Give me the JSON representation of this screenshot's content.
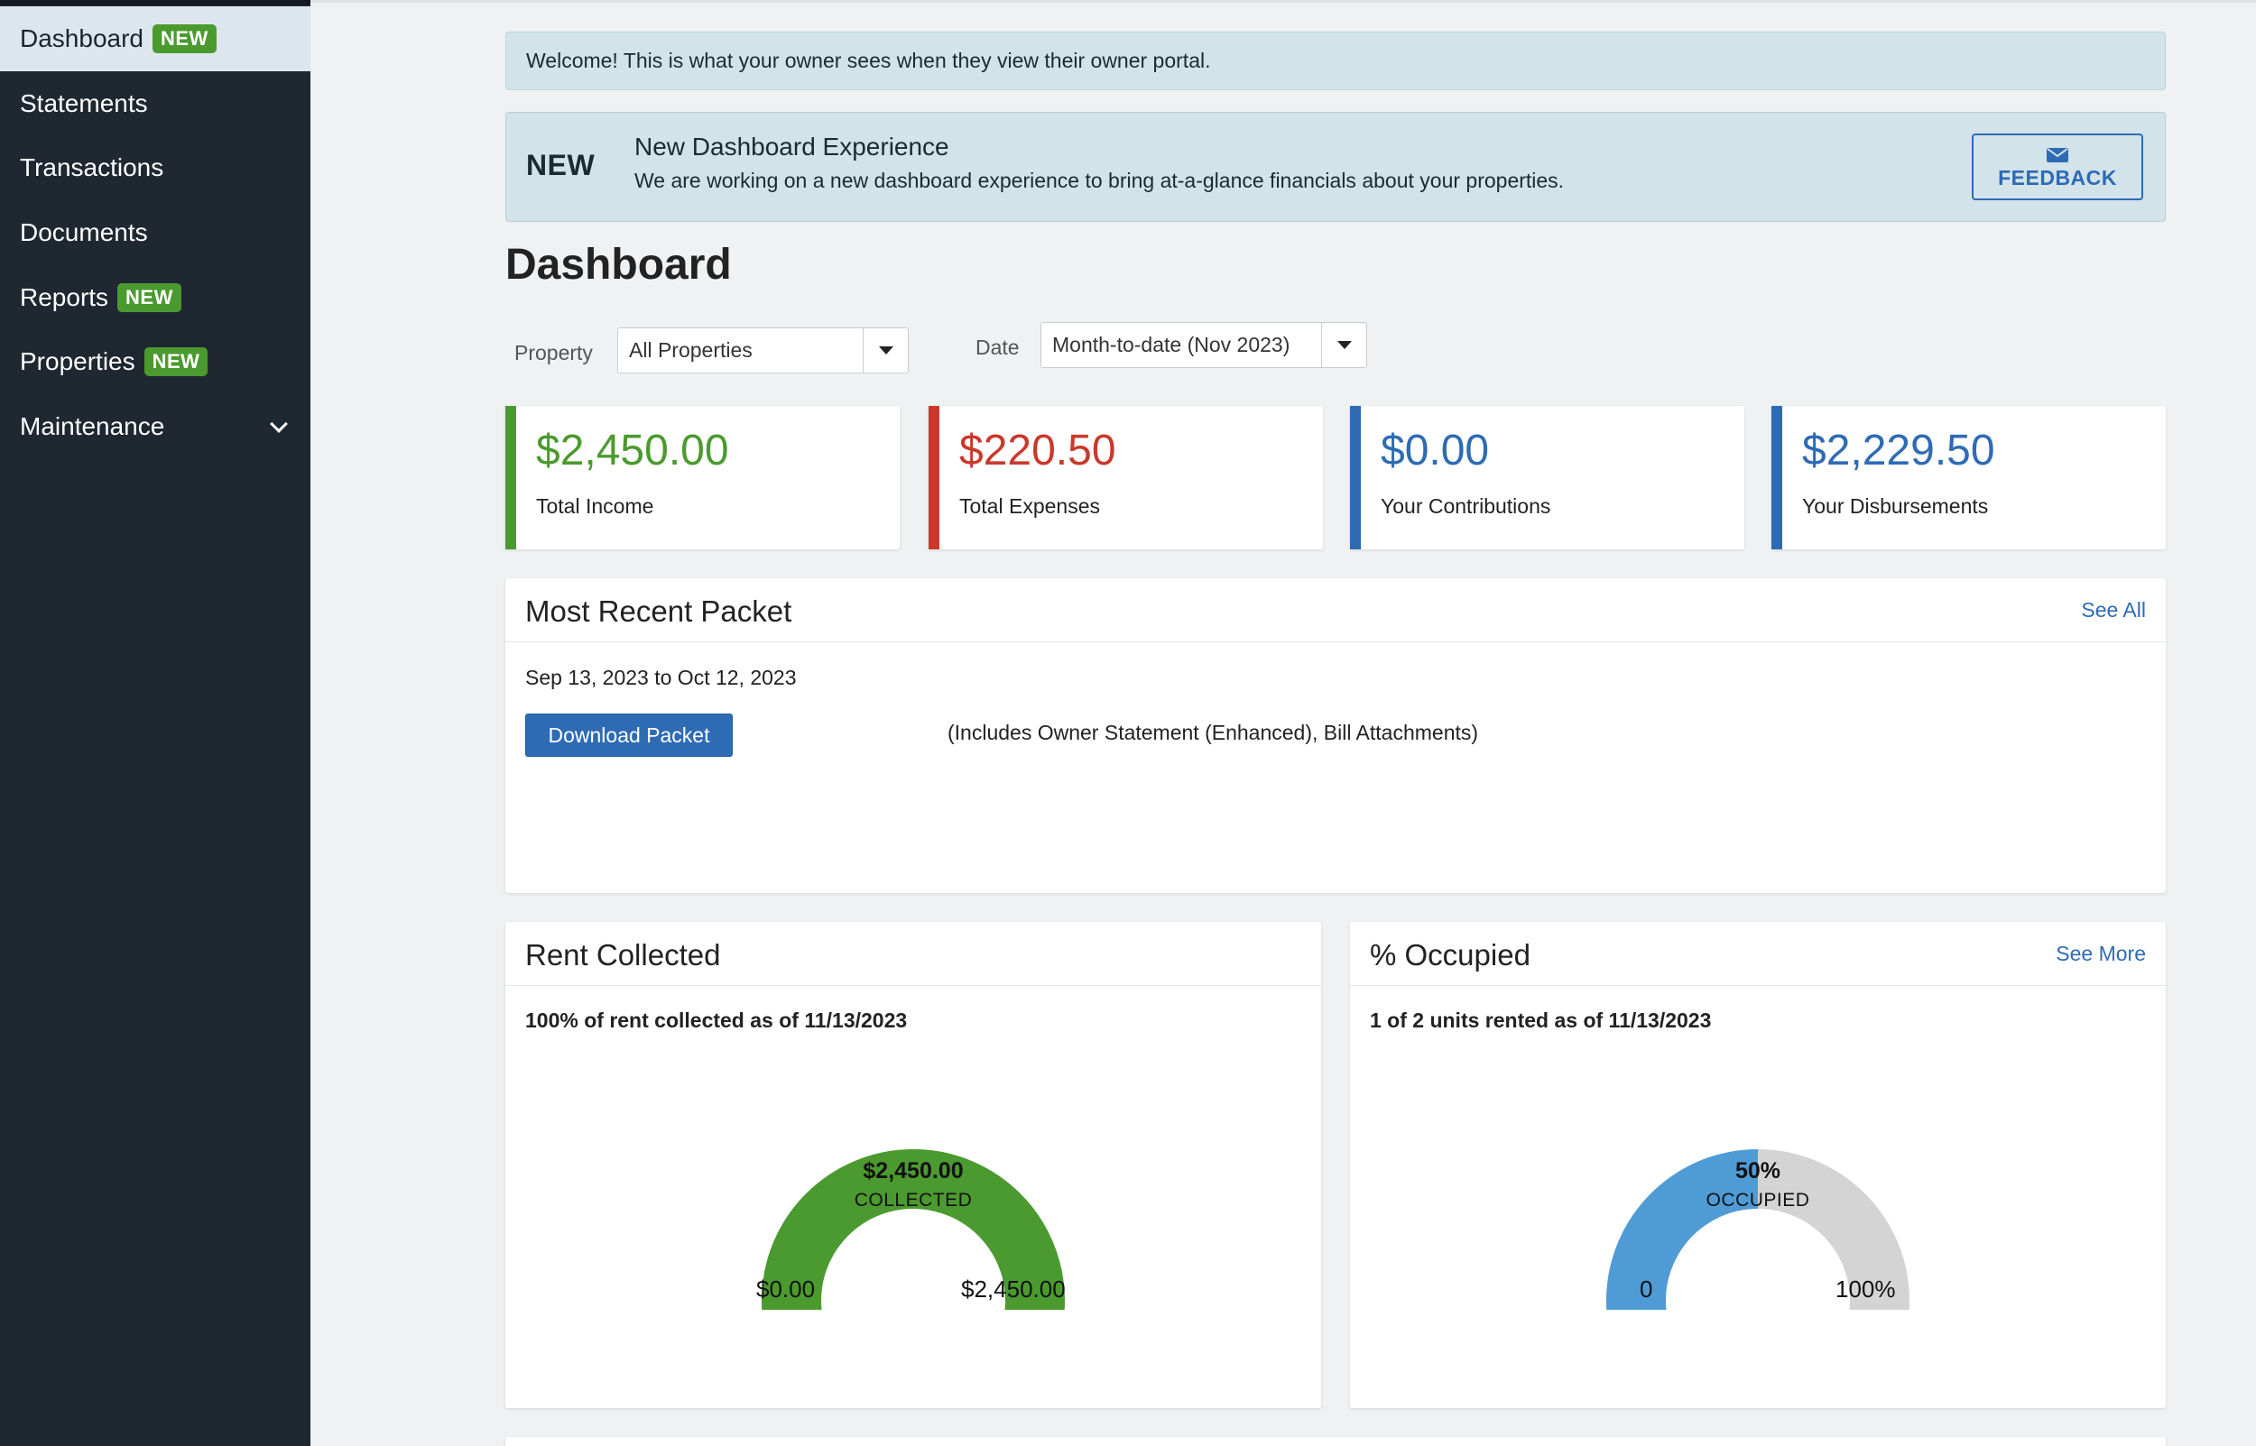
{
  "sidebar": {
    "items": [
      {
        "label": "Dashboard",
        "badge": "NEW"
      },
      {
        "label": "Statements",
        "badge": ""
      },
      {
        "label": "Transactions",
        "badge": ""
      },
      {
        "label": "Documents",
        "badge": ""
      },
      {
        "label": "Reports",
        "badge": "NEW"
      },
      {
        "label": "Properties",
        "badge": "NEW"
      },
      {
        "label": "Maintenance",
        "badge": ""
      }
    ],
    "active_item": "Dashboard"
  },
  "alert": {
    "text": "Welcome! This is what your owner sees when they view their owner portal."
  },
  "promo": {
    "badge": "NEW",
    "title": "New Dashboard Experience",
    "description": "We are working on a new dashboard experience to bring at-a-glance financials about your properties.",
    "feedback_label": "FEEDBACK",
    "feedback_icon": "envelope-icon"
  },
  "page": {
    "title": "Dashboard"
  },
  "filters": {
    "property_label": "Property",
    "property_value": "All Properties",
    "date_label": "Date",
    "date_value": "Month-to-date (Nov 2023)"
  },
  "stats": [
    {
      "value": "$2,450.00",
      "label": "Total Income",
      "color": "#4b9a2f"
    },
    {
      "value": "$220.50",
      "label": "Total Expenses",
      "color": "#c9392b"
    },
    {
      "value": "$0.00",
      "label": "Your Contributions",
      "color": "#2e6bb5"
    },
    {
      "value": "$2,229.50",
      "label": "Your Disbursements",
      "color": "#2e6bb5"
    }
  ],
  "packet": {
    "title": "Most Recent Packet",
    "see_all": "See All",
    "date_range": "Sep 13, 2023 to Oct 12, 2023",
    "download_label": "Download Packet",
    "includes": "(Includes Owner Statement (Enhanced), Bill Attachments)"
  },
  "rent": {
    "title": "Rent Collected",
    "subtitle": "100% of rent collected as of 11/13/2023",
    "center_value": "$2,450.00",
    "center_label": "COLLECTED",
    "min_label": "$0.00",
    "max_label": "$2,450.00",
    "fraction": 1.0,
    "fill_color": "#4b9a2f",
    "track_color": "#d4d4d4"
  },
  "occupied": {
    "title": "% Occupied",
    "see_more": "See More",
    "subtitle": "1 of 2 units rented as of 11/13/2023",
    "center_value": "50%",
    "center_label": "OCCUPIED",
    "min_label": "0",
    "max_label": "100%",
    "fraction": 0.5,
    "fill_color": "#4f9bd5",
    "track_color": "#d4d4d4"
  },
  "colors": {
    "sidebar_bg": "#1f2731",
    "accent": "#2e6bb5",
    "badge": "#4b9a2f"
  }
}
